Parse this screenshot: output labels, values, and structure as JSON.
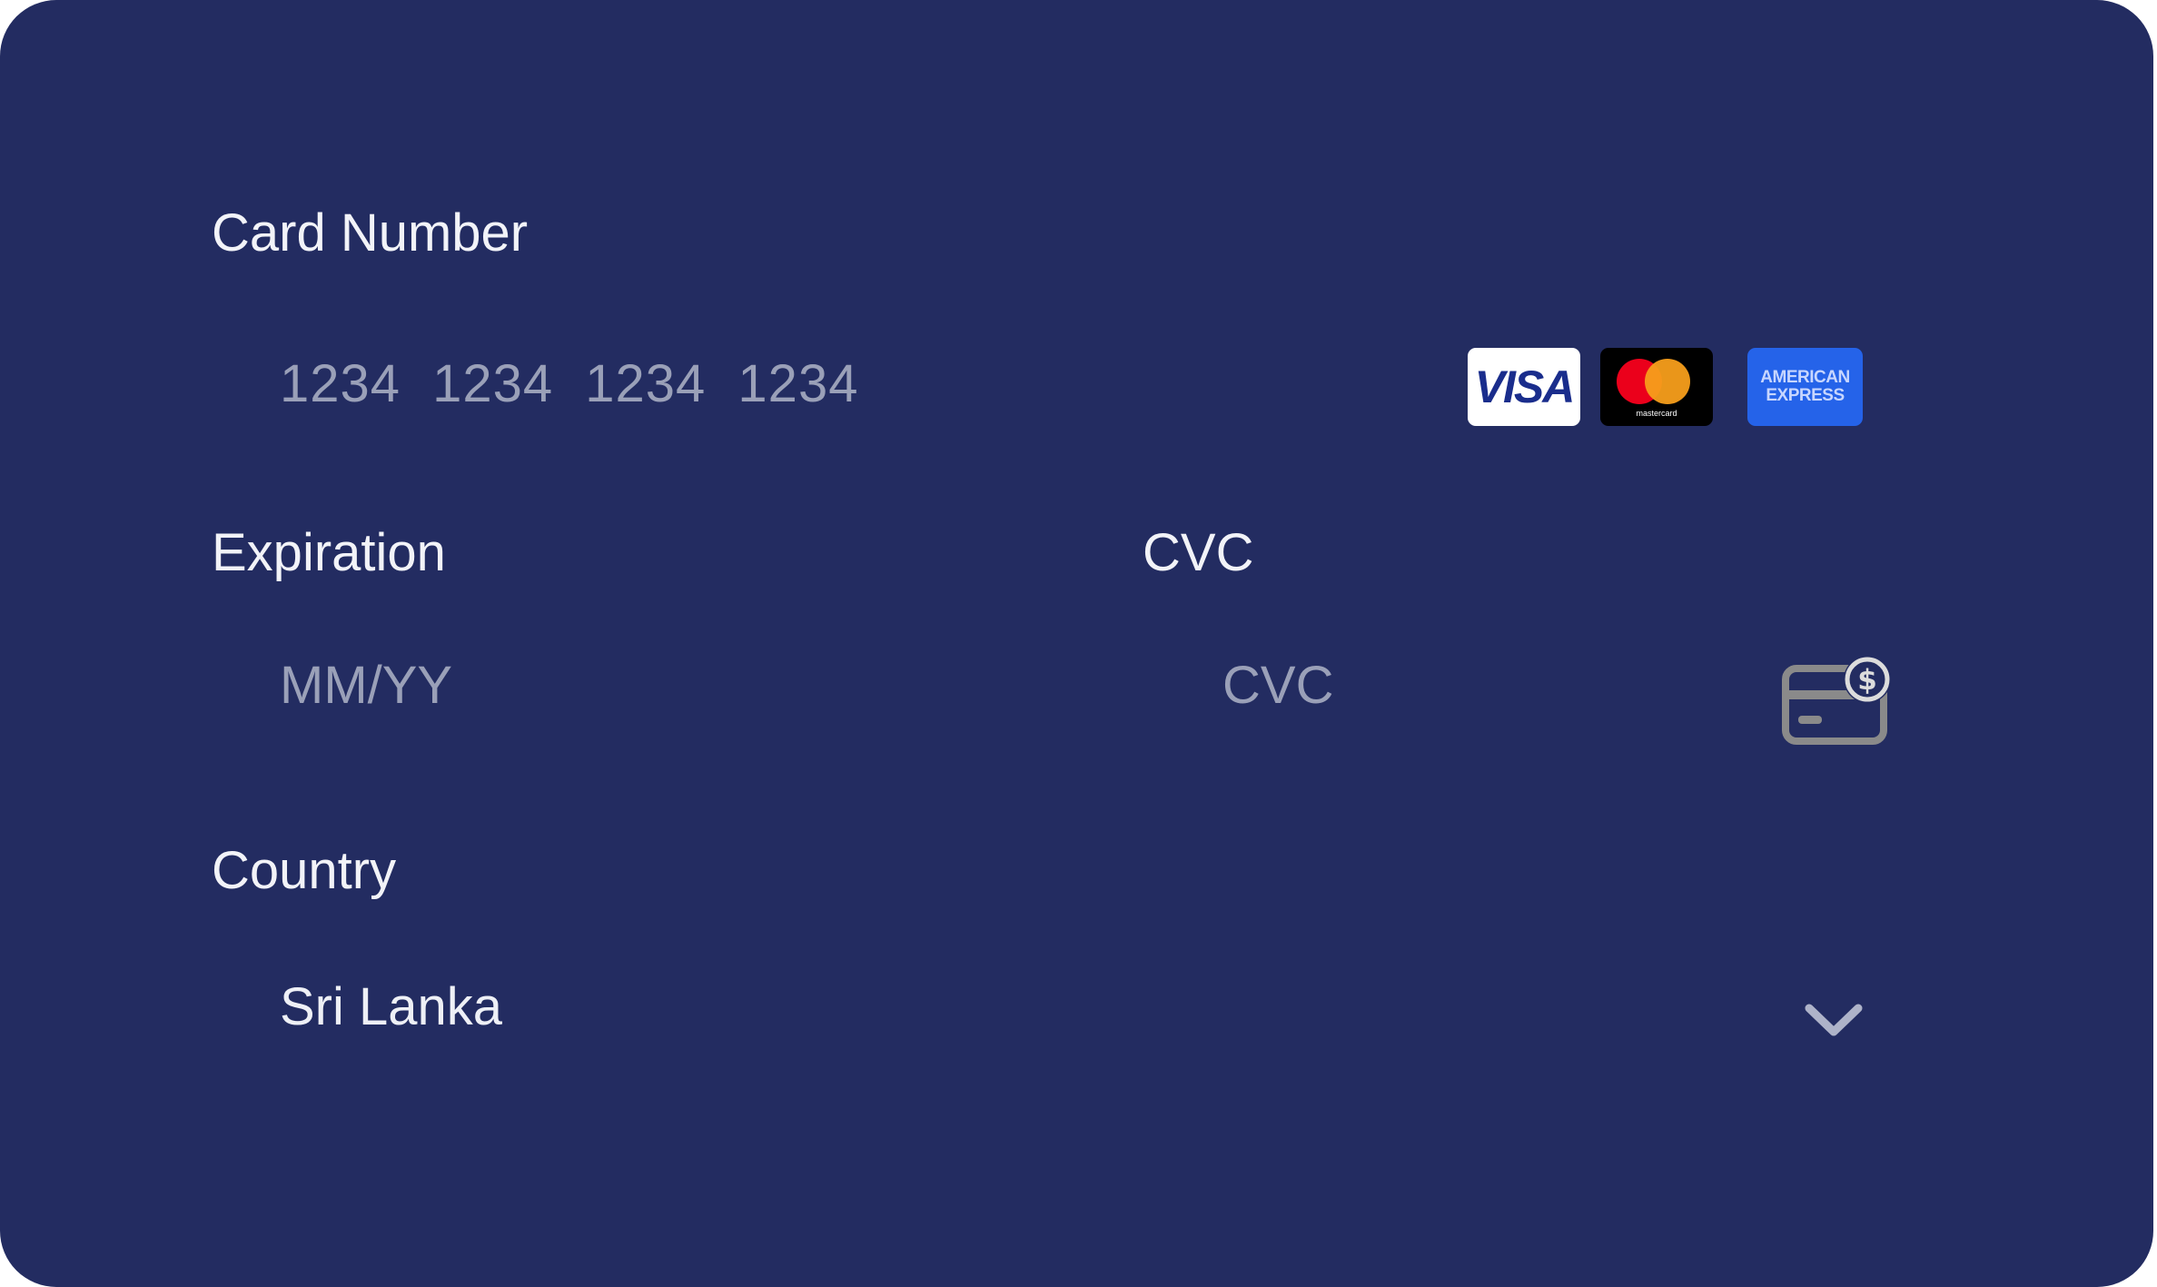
{
  "card_number": {
    "label": "Card Number",
    "placeholder": "1234 1234 1234 1234",
    "brands": {
      "visa": "VISA",
      "mastercard": "mastercard",
      "amex": [
        "AMERICAN",
        "EXPRESS"
      ]
    }
  },
  "expiration": {
    "label": "Expiration",
    "placeholder": "MM/YY"
  },
  "cvc": {
    "label": "CVC",
    "placeholder": "CVC",
    "icon": "card-cvc-icon"
  },
  "country": {
    "label": "Country",
    "selected": "Sri Lanka",
    "icon": "chevron-down-icon"
  },
  "colors": {
    "card_background": "#232c61",
    "label_text": "#f2f3f8",
    "placeholder_text": "#9aa0b8",
    "icon_gray": "#8a8a8a",
    "amex_blue": "#2563e9",
    "mastercard_red": "#eb001b",
    "mastercard_orange": "#f79e1b"
  }
}
